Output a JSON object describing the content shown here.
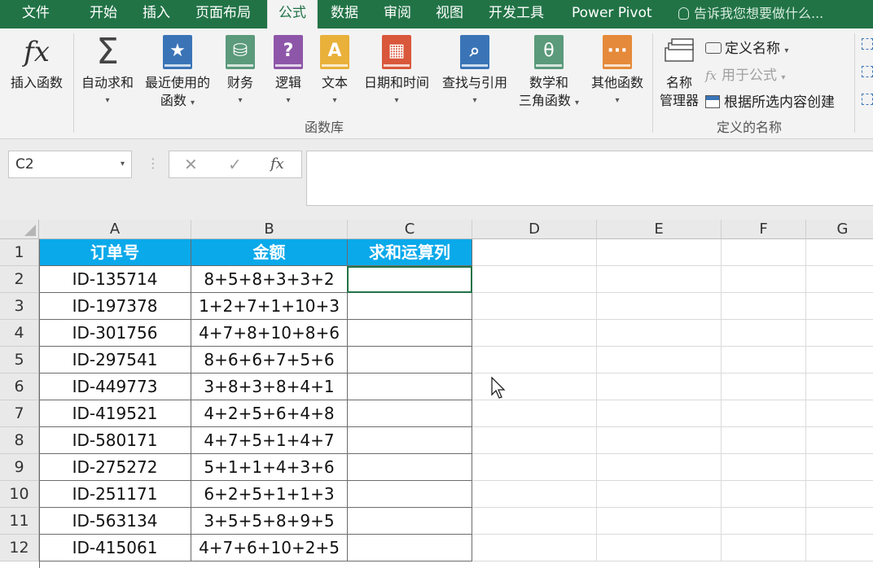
{
  "menu": {
    "tabs": [
      "文件",
      "开始",
      "插入",
      "页面布局",
      "公式",
      "数据",
      "审阅",
      "视图",
      "开发工具",
      "Power Pivot"
    ],
    "active_tab": "公式",
    "tell_me": "告诉我您想要做什么..."
  },
  "ribbon": {
    "insert_function": "插入函数",
    "autosum": "自动求和",
    "recent_line1": "最近使用的",
    "recent_line2": "函数",
    "financial": "财务",
    "logical": "逻辑",
    "text": "文本",
    "datetime": "日期和时间",
    "lookup": "查找与引用",
    "math_line1": "数学和",
    "math_line2": "三角函数",
    "more": "其他函数",
    "function_library": "函数库",
    "name_manager_line1": "名称",
    "name_manager_line2": "管理器",
    "define_name": "定义名称",
    "use_in_formula": "用于公式",
    "create_from_selection": "根据所选内容创建",
    "defined_names": "定义的名称"
  },
  "formula_bar": {
    "name_box": "C2",
    "formula": ""
  },
  "grid": {
    "columns": [
      "A",
      "B",
      "C",
      "D",
      "E",
      "F",
      "G"
    ],
    "rows": [
      "1",
      "2",
      "3",
      "4",
      "5",
      "6",
      "7",
      "8",
      "9",
      "10",
      "11",
      "12"
    ],
    "headers": [
      "订单号",
      "金额",
      "求和运算列"
    ],
    "data": [
      [
        "ID-135714",
        "8+5+8+3+3+2",
        ""
      ],
      [
        "ID-197378",
        "1+2+7+1+10+3",
        ""
      ],
      [
        "ID-301756",
        "4+7+8+10+8+6",
        ""
      ],
      [
        "ID-297541",
        "8+6+6+7+5+6",
        ""
      ],
      [
        "ID-449773",
        "3+8+3+8+4+1",
        ""
      ],
      [
        "ID-419521",
        "4+2+5+6+4+8",
        ""
      ],
      [
        "ID-580171",
        "4+7+5+1+4+7",
        ""
      ],
      [
        "ID-275272",
        "5+1+1+4+3+6",
        ""
      ],
      [
        "ID-251171",
        "6+2+5+1+1+3",
        ""
      ],
      [
        "ID-563134",
        "3+5+5+8+9+5",
        ""
      ],
      [
        "ID-415061",
        "4+7+6+10+2+5",
        ""
      ]
    ]
  },
  "colors": {
    "accent": "#217346",
    "header_fill": "#0aa9ea"
  }
}
